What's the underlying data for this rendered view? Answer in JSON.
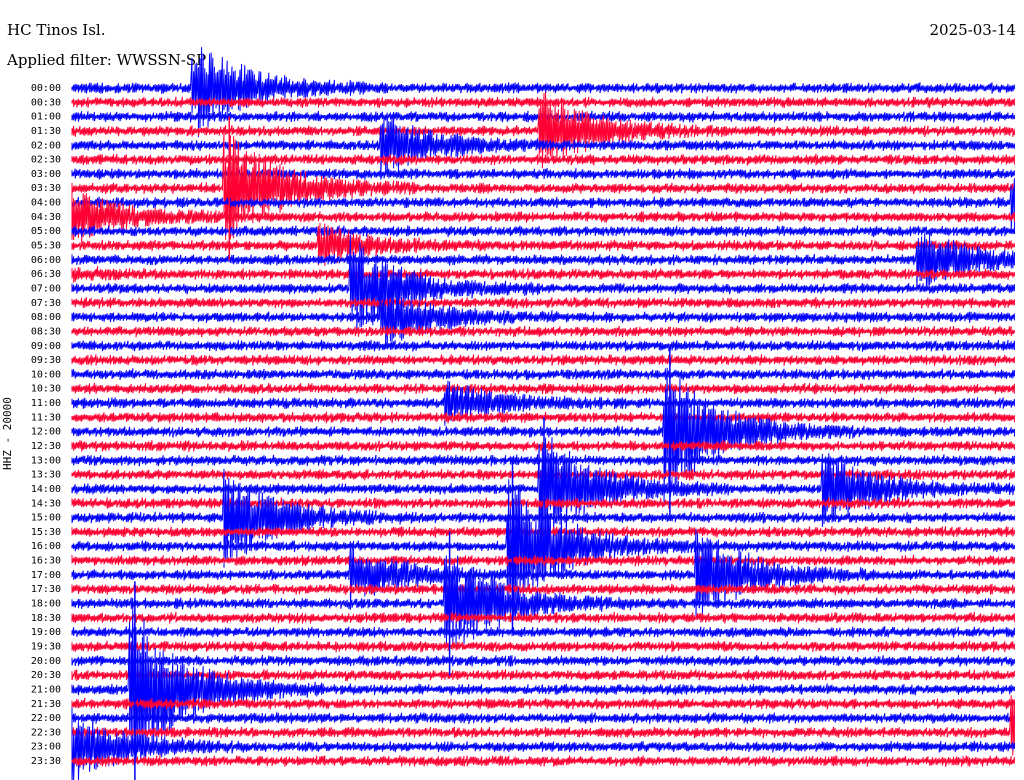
{
  "header": {
    "station": "HC Tinos Isl.",
    "date": "2025-03-14",
    "filter_label": "Applied filter: WWSSN-SP"
  },
  "y_axis_label": "HHZ - 20000",
  "colors": {
    "trace_a": "#0000ff",
    "trace_b": "#ff0033",
    "background": "#ffffff",
    "text": "#000000"
  },
  "chart_data": {
    "type": "line",
    "title": "HC Tinos Isl.",
    "subtitle": "Applied filter: WWSSN-SP",
    "ylabel": "HHZ - 20000",
    "xlabel": "",
    "row_labels": [
      "00:00",
      "00:30",
      "01:00",
      "01:30",
      "02:00",
      "02:30",
      "03:00",
      "03:30",
      "04:00",
      "04:30",
      "05:00",
      "05:30",
      "06:00",
      "06:30",
      "07:00",
      "07:30",
      "08:00",
      "08:30",
      "09:00",
      "09:30",
      "10:00",
      "10:30",
      "11:00",
      "11:30",
      "12:00",
      "12:30",
      "13:00",
      "13:30",
      "14:00",
      "14:30",
      "15:00",
      "15:30",
      "16:00",
      "16:30",
      "17:00",
      "17:30",
      "18:00",
      "18:30",
      "19:00",
      "19:30",
      "20:00",
      "20:30",
      "21:00",
      "21:30",
      "22:00",
      "22:30",
      "23:00",
      "23:30"
    ],
    "trace_colors": [
      "#0000ff",
      "#ff0033"
    ],
    "row_minutes": 30,
    "events": [
      {
        "time": "00:04",
        "amplitude": 5
      },
      {
        "time": "01:45",
        "amplitude": 4
      },
      {
        "time": "02:10",
        "amplitude": 3
      },
      {
        "time": "03:35",
        "amplitude": 6
      },
      {
        "time": "04:30",
        "amplitude": 3
      },
      {
        "time": "05:38",
        "amplitude": 2
      },
      {
        "time": "06:27",
        "amplitude": 3
      },
      {
        "time": "07:09",
        "amplitude": 5
      },
      {
        "time": "08:10",
        "amplitude": 3
      },
      {
        "time": "11:12",
        "amplitude": 2
      },
      {
        "time": "12:19",
        "amplitude": 7
      },
      {
        "time": "14:15",
        "amplitude": 6
      },
      {
        "time": "14:24",
        "amplitude": 4
      },
      {
        "time": "15:05",
        "amplitude": 5
      },
      {
        "time": "16:14",
        "amplitude": 7
      },
      {
        "time": "17:09",
        "amplitude": 3
      },
      {
        "time": "17:20",
        "amplitude": 5
      },
      {
        "time": "18:12",
        "amplitude": 6
      },
      {
        "time": "21:02",
        "amplitude": 9
      },
      {
        "time": "23:00",
        "amplitude": 4
      }
    ]
  }
}
